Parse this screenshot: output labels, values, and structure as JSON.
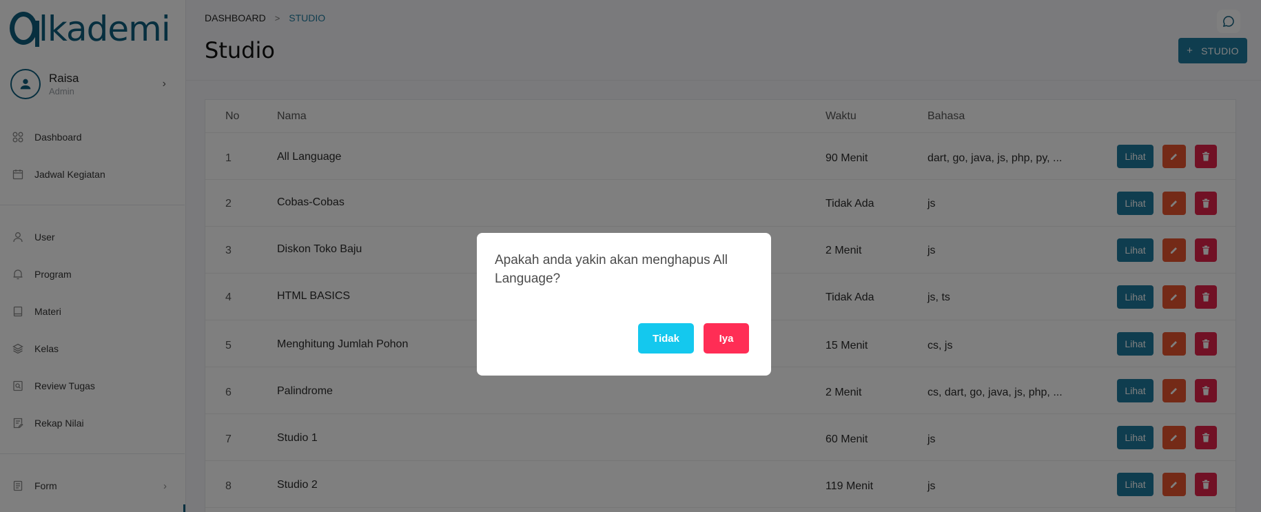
{
  "brand": {
    "logo_text": "Alkademi",
    "accent": "#0f5e7e"
  },
  "profile": {
    "name": "Raisa",
    "role": "Admin"
  },
  "nav": [
    {
      "label": "Dashboard",
      "icon": "grid-icon"
    },
    {
      "label": "Jadwal Kegiatan",
      "icon": "calendar-icon"
    },
    {
      "label": "User",
      "icon": "user-icon"
    },
    {
      "label": "Program",
      "icon": "bell-icon"
    },
    {
      "label": "Materi",
      "icon": "book-icon"
    },
    {
      "label": "Kelas",
      "icon": "layers-icon"
    },
    {
      "label": "Review Tugas",
      "icon": "review-icon"
    },
    {
      "label": "Rekap Nilai",
      "icon": "edit-doc-icon"
    },
    {
      "label": "Form",
      "icon": "form-icon"
    }
  ],
  "breadcrumb": {
    "root": "DASHBOARD",
    "current": "STUDIO"
  },
  "page": {
    "title": "Studio",
    "add_label": "STUDIO"
  },
  "table": {
    "headers": {
      "no": "No",
      "nama": "Nama",
      "waktu": "Waktu",
      "bahasa": "Bahasa"
    },
    "action_view": "Lihat",
    "rows": [
      {
        "no": "1",
        "nama": "All Language",
        "waktu": "90 Menit",
        "bahasa": "dart, go, java, js, php, py, ..."
      },
      {
        "no": "2",
        "nama": "Cobas-Cobas",
        "waktu": "Tidak Ada",
        "bahasa": "js"
      },
      {
        "no": "3",
        "nama": "Diskon Toko Baju",
        "waktu": "2 Menit",
        "bahasa": "js"
      },
      {
        "no": "4",
        "nama": "HTML BASICS",
        "waktu": "Tidak Ada",
        "bahasa": "js, ts"
      },
      {
        "no": "5",
        "nama": "Menghitung Jumlah Pohon",
        "waktu": "15 Menit",
        "bahasa": "cs, js"
      },
      {
        "no": "6",
        "nama": "Palindrome",
        "waktu": "2 Menit",
        "bahasa": "cs, dart, go, java, js, php, ..."
      },
      {
        "no": "7",
        "nama": "Studio 1",
        "waktu": "60 Menit",
        "bahasa": "js"
      },
      {
        "no": "8",
        "nama": "Studio 2",
        "waktu": "119 Menit",
        "bahasa": "js"
      }
    ]
  },
  "dialog": {
    "message": "Apakah anda yakin akan menghapus All Language?",
    "cancel_label": "Tidak",
    "confirm_label": "Iya"
  }
}
